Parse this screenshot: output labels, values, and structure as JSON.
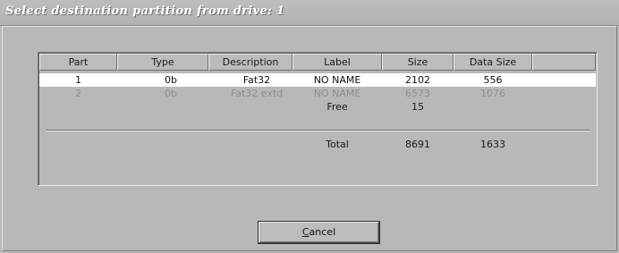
{
  "window": {
    "title": "Select destination partition from drive: 1"
  },
  "table": {
    "columns": [
      "Part",
      "Type",
      "Description",
      "Label",
      "Size",
      "Data Size"
    ],
    "rows": [
      {
        "part": "1",
        "type": "0b",
        "description": "Fat32",
        "label": "NO NAME",
        "size": "2102",
        "data_size": "556",
        "state": "selected"
      },
      {
        "part": "2",
        "type": "0b",
        "description": "Fat32 extd",
        "label": "NO NAME",
        "size": "6573",
        "data_size": "1076",
        "state": "disabled"
      },
      {
        "part": "",
        "type": "",
        "description": "",
        "label": "Free",
        "size": "15",
        "data_size": "",
        "state": "normal"
      }
    ],
    "total": {
      "label": "Total",
      "size": "8691",
      "data_size": "1633"
    }
  },
  "buttons": {
    "cancel": {
      "accel": "C",
      "rest": "ancel"
    }
  }
}
